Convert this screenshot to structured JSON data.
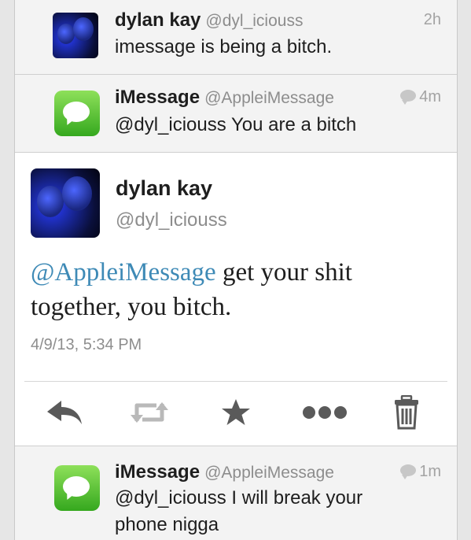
{
  "tweets_above": [
    {
      "name": "dylan kay",
      "handle": "@dyl_iciouss",
      "text": "imessage is being a bitch.",
      "time": "2h"
    },
    {
      "name": "iMessage",
      "handle": "@AppleiMessage",
      "text": "@dyl_iciouss You are a bitch",
      "time": "4m"
    }
  ],
  "detail": {
    "name": "dylan kay",
    "handle": "@dyl_iciouss",
    "mention": "@AppleiMessage",
    "text_rest": " get your shit together, you bitch.",
    "timestamp": "4/9/13, 5:34 PM",
    "actions": [
      "reply-icon",
      "retweet-icon",
      "favorite-icon",
      "more-icon",
      "delete-icon"
    ]
  },
  "tweets_below": [
    {
      "name": "iMessage",
      "handle": "@AppleiMessage",
      "text": "@dyl_iciouss I will break your phone nigga",
      "time": "1m"
    }
  ],
  "colors": {
    "mention": "#3e8ab6",
    "avatar_blue": "#1b2aa8",
    "imessage_green": "#35a81e",
    "action_gray": "#5a5a5a"
  }
}
